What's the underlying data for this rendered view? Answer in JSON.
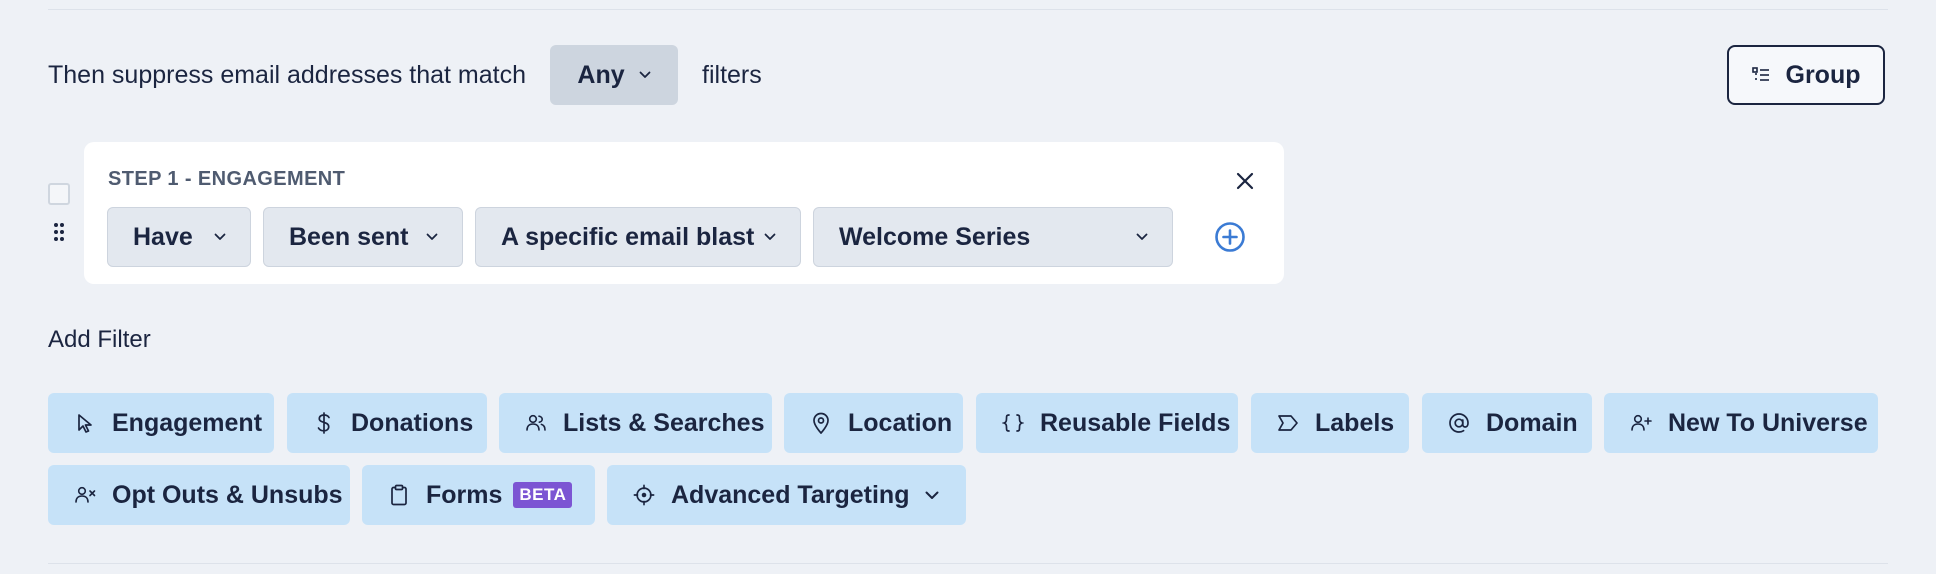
{
  "suppress": {
    "prefix": "Then suppress email addresses that match",
    "match_value": "Any",
    "suffix": "filters"
  },
  "group_button": {
    "label": "Group"
  },
  "step": {
    "title": "STEP 1 - ENGAGEMENT",
    "selects": {
      "have": "Have",
      "action": "Been sent",
      "target": "A specific email blast",
      "blast": "Welcome Series"
    }
  },
  "add_filter": {
    "label": "Add Filter",
    "chips": {
      "engagement": "Engagement",
      "donations": "Donations",
      "lists": "Lists & Searches",
      "location": "Location",
      "reusable": "Reusable Fields",
      "labels": "Labels",
      "domain": "Domain",
      "new_universe": "New To Universe",
      "optouts": "Opt Outs & Unsubs",
      "forms": "Forms",
      "forms_badge": "BETA",
      "advanced": "Advanced Targeting"
    }
  },
  "colors": {
    "background": "#eef1f6",
    "text": "#1b2540",
    "chip": "#c6e2f8",
    "select": "#e3e8ef",
    "accent_blue": "#3b7bd4",
    "beta_badge": "#7c55d3"
  }
}
